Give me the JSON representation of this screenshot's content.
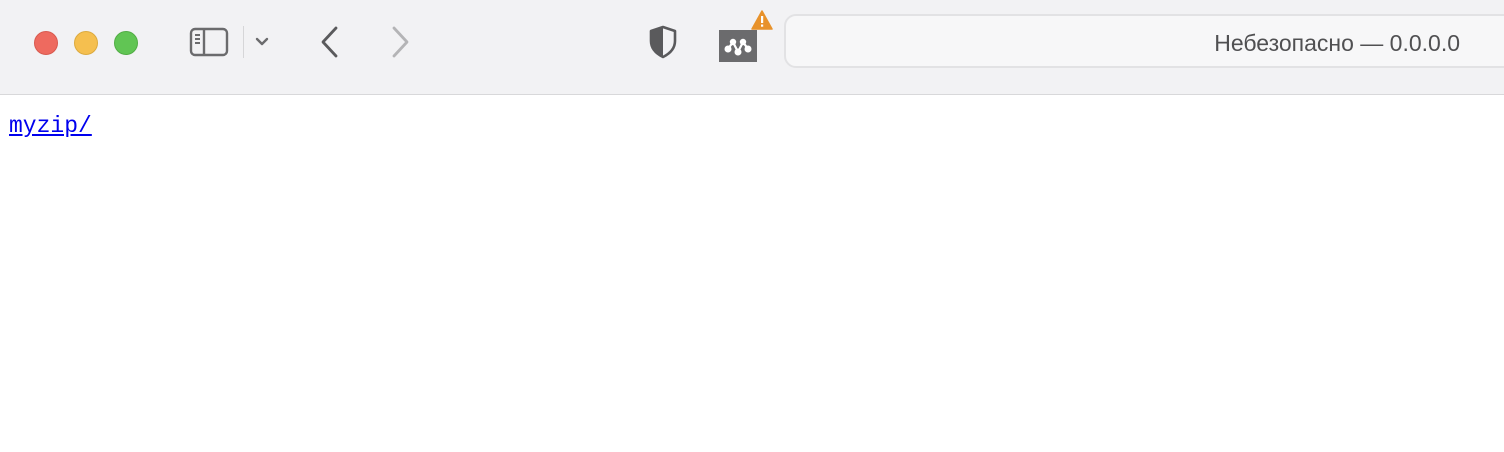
{
  "browser": {
    "window_controls": {
      "close_color": "#ee6a5f",
      "minimize_color": "#f5bf4f",
      "maximize_color": "#61c554"
    },
    "toolbar": {
      "icons": [
        "sidebar-icon",
        "chevron-down-icon",
        "back-arrow-icon",
        "forward-arrow-icon",
        "shield-icon",
        "extension-icon",
        "warning-icon"
      ],
      "extension_badge_color": "#e8922b"
    },
    "address_bar": {
      "text": "Небезопасно — 0.0.0.0"
    }
  },
  "page": {
    "links": [
      {
        "label": "myzip/"
      }
    ],
    "link_color": "#0000ee"
  }
}
